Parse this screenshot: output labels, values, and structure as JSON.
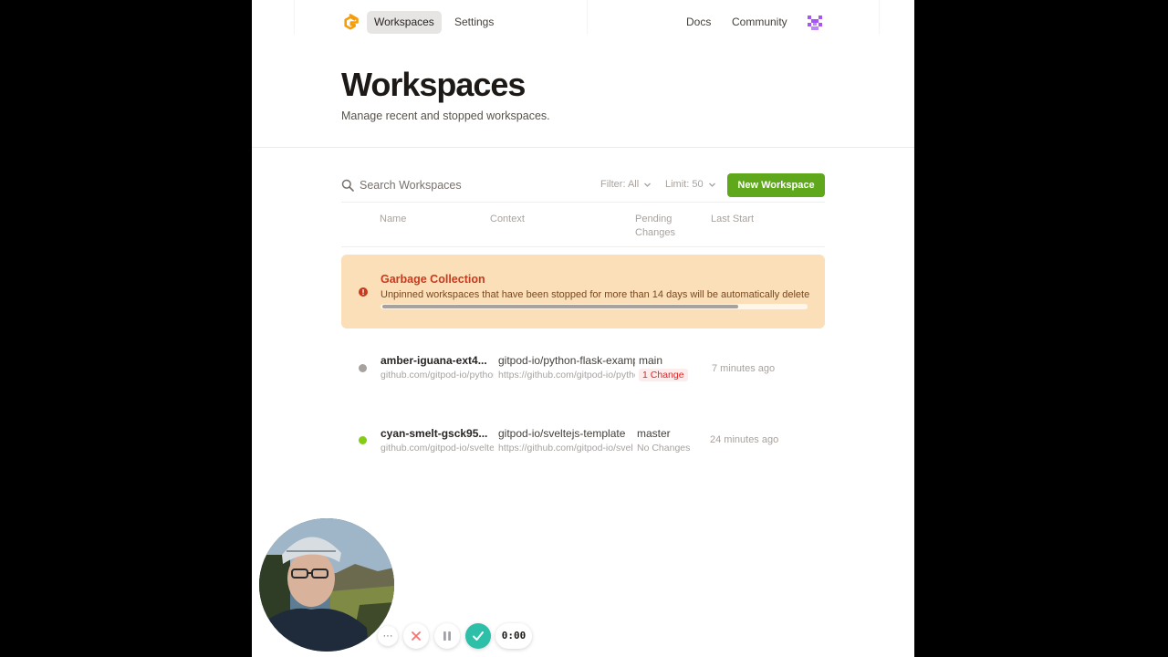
{
  "nav": {
    "workspaces_label": "Workspaces",
    "settings_label": "Settings",
    "docs_label": "Docs",
    "community_label": "Community",
    "logo_icon": "gitpod-logo-icon",
    "avatar_icon": "user-avatar-icon"
  },
  "header": {
    "title": "Workspaces",
    "subtitle": "Manage recent and stopped workspaces."
  },
  "toolbar": {
    "search_placeholder": "Search Workspaces",
    "filter_label": "Filter: All",
    "limit_label": "Limit: 50",
    "new_workspace_label": "New Workspace"
  },
  "columns": {
    "name": "Name",
    "context": "Context",
    "pending_line1": "Pending",
    "pending_line2": "Changes",
    "last_start": "Last Start"
  },
  "banner": {
    "title": "Garbage Collection",
    "text": "Unpinned workspaces that have been stopped for more than 14 days will be automatically deleted.",
    "scroll_fraction": 0.84,
    "icon": "alert-circle-icon"
  },
  "workspaces": [
    {
      "name": "amber-iguana-ext4...",
      "repo": "github.com/gitpod-io/python-flask-example",
      "context": "gitpod-io/python-flask-example",
      "context_url": "https://github.com/gitpod-io/python-flask-example",
      "branch": "main",
      "changes": "1 Change",
      "last_start": "7 minutes ago",
      "status_color": "#a8a29e"
    },
    {
      "name": "cyan-smelt-gsck95...",
      "repo": "github.com/gitpod-io/sveltejs-template",
      "context": "gitpod-io/sveltejs-template",
      "context_url": "https://github.com/gitpod-io/sveltejs-template",
      "branch": "master",
      "changes": "No Changes",
      "last_start": "24 minutes ago",
      "status_color": "#84cc16"
    }
  ],
  "recorder": {
    "time": "0:00",
    "more_label": "···"
  },
  "colors": {
    "accent_green": "#5fa81b",
    "banner_bg": "#fbdfb9",
    "banner_title": "#c73a1d",
    "change_red": "#dc2626"
  }
}
